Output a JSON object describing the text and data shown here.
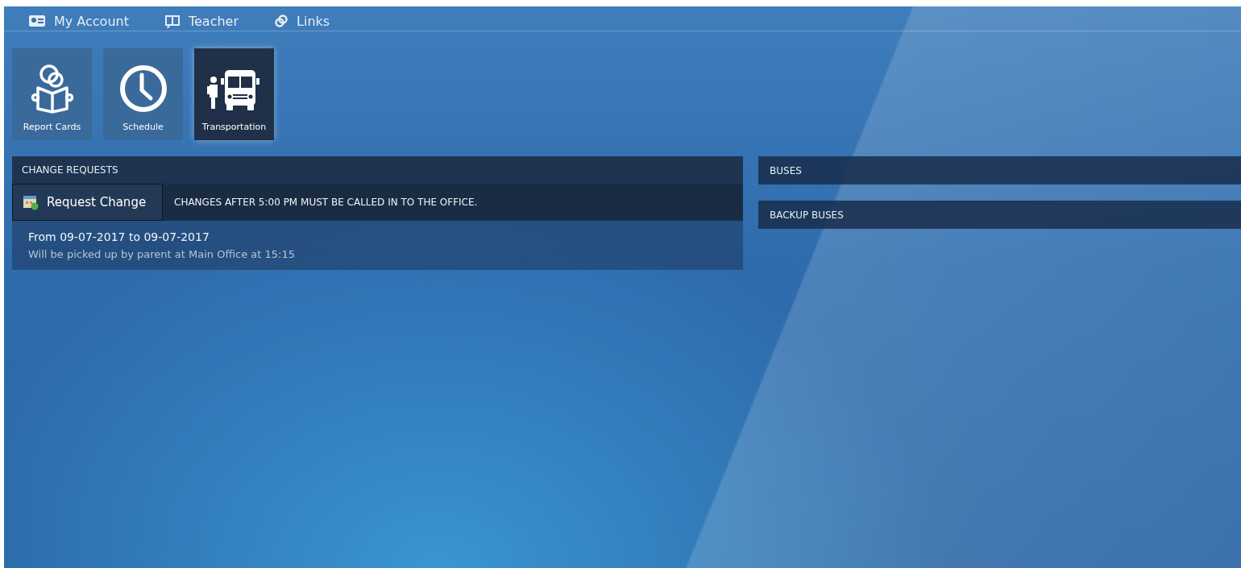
{
  "nav": [
    {
      "label": "My Account",
      "kind": "account"
    },
    {
      "label": "Teacher",
      "kind": "teacher"
    },
    {
      "label": "Links",
      "kind": "links"
    }
  ],
  "tiles": [
    {
      "label": "Report Cards",
      "kind": "reader",
      "selected": false
    },
    {
      "label": "Schedule",
      "kind": "clock",
      "selected": false
    },
    {
      "label": "Transportation",
      "kind": "bus",
      "selected": true
    }
  ],
  "change_requests": {
    "title": "CHANGE REQUESTS",
    "button": "Request Change",
    "notice": "CHANGES AFTER 5:00 PM MUST BE CALLED IN TO THE OFFICE.",
    "entries": [
      {
        "dates": "From 09-07-2017 to 09-07-2017",
        "detail": "Will be picked up by parent at Main Office at 15:15"
      }
    ]
  },
  "side_panels": [
    {
      "title": "BUSES"
    },
    {
      "title": "BACKUP BUSES"
    }
  ]
}
